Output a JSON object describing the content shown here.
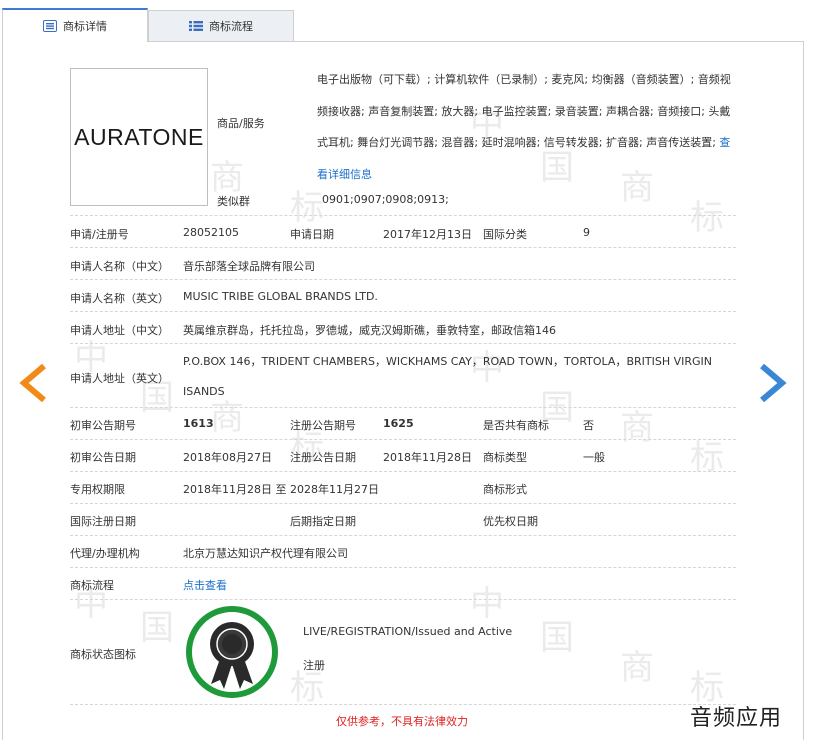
{
  "tabs": {
    "detail": "商标详情",
    "flow": "商标流程"
  },
  "logo_text": "AURATONE",
  "goods": {
    "label": "商品/服务",
    "text": "电子出版物（可下载）; 计算机软件（已录制）; 麦克风; 均衡器（音频装置）; 音频视频接收器; 声音复制装置; 放大器; 电子监控装置; 录音装置; 声耦合器; 音频接口; 头戴式耳机; 舞台灯光调节器; 混音器; 延时混响器; 信号转发器; 扩音器; 声音传送装置;",
    "more_link": "查看详细信息"
  },
  "similar_group": {
    "label": "类似群",
    "value": "0901;0907;0908;0913;"
  },
  "fields": {
    "reg_no_label": "申请/注册号",
    "reg_no": "28052105",
    "apply_date_label": "申请日期",
    "apply_date": "2017年12月13日",
    "intl_class_label": "国际分类",
    "intl_class": "9",
    "applicant_cn_label": "申请人名称（中文）",
    "applicant_cn": "音乐部落全球品牌有限公司",
    "applicant_en_label": "申请人名称（英文）",
    "applicant_en": "MUSIC TRIBE GLOBAL BRANDS LTD.",
    "addr_cn_label": "申请人地址（中文）",
    "addr_cn": "英属维京群岛，托托拉岛，罗德城，威克汉姆斯礁，垂敦特室，邮政信箱146",
    "addr_en_label": "申请人地址（英文）",
    "addr_en_line1": "P.O.BOX 146，TRIDENT CHAMBERS，WICKHAMS CAY，ROAD TOWN，TORTOLA，BRITISH VIRGIN",
    "addr_en_line2": "ISANDS",
    "prelim_no_label": "初审公告期号",
    "prelim_no": "1613",
    "reg_pub_no_label": "注册公告期号",
    "reg_pub_no": "1625",
    "shared_label": "是否共有商标",
    "shared": "否",
    "prelim_date_label": "初审公告日期",
    "prelim_date": "2018年08月27日",
    "reg_pub_date_label": "注册公告日期",
    "reg_pub_date": "2018年11月28日",
    "mark_type_label": "商标类型",
    "mark_type": "一般",
    "term_label": "专用权期限",
    "term": "2018年11月28日 至 2028年11月27日",
    "mark_form_label": "商标形式",
    "intl_reg_date_label": "国际注册日期",
    "later_date_label": "后期指定日期",
    "priority_date_label": "优先权日期",
    "agent_label": "代理/办理机构",
    "agent": "北京万慧达知识产权代理有限公司",
    "flow_label": "商标流程",
    "flow_link": "点击查看",
    "status_label": "商标状态图标",
    "status_en": "LIVE/REGISTRATION/Issued and Active",
    "status_cn": "注册"
  },
  "disclaimer": "仅供参考，不具有法律效力",
  "corner_brand": "音频应用",
  "watermark_chars": [
    "中",
    "国",
    "商",
    "标"
  ],
  "colors": {
    "link": "#1a6fc9",
    "arrow_prev": "#f28a1a",
    "arrow_next": "#3a87d6",
    "cert_ring": "#1f9a3a",
    "disclaimer": "#e02020"
  }
}
